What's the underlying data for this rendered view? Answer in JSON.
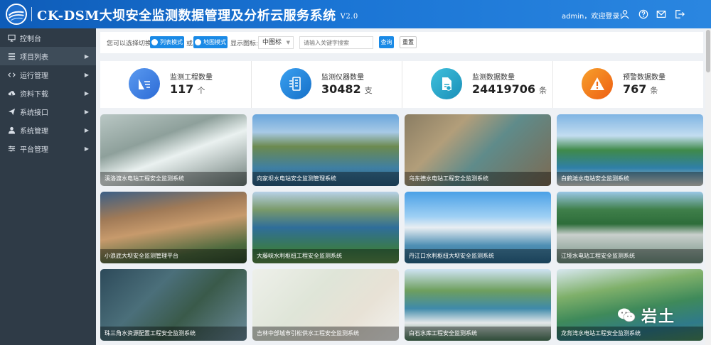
{
  "header": {
    "title": "CK-DSM大坝安全监测数据管理及分析云服务系统",
    "version": "V2.0",
    "greeting": "admin，欢迎登录!",
    "icons": [
      "user-icon",
      "help-icon",
      "mail-icon",
      "logout-icon"
    ]
  },
  "sidebar": {
    "items": [
      {
        "label": "控制台",
        "icon": "monitor-icon",
        "arrow": ""
      },
      {
        "label": "项目列表",
        "icon": "list-icon",
        "arrow": "▶"
      },
      {
        "label": "运行管理",
        "icon": "code-icon",
        "arrow": "▶"
      },
      {
        "label": "资料下载",
        "icon": "cloud-download-icon",
        "arrow": "▶"
      },
      {
        "label": "系统接口",
        "icon": "send-icon",
        "arrow": "▶"
      },
      {
        "label": "系统管理",
        "icon": "user-icon",
        "arrow": "▶"
      },
      {
        "label": "平台管理",
        "icon": "sliders-icon",
        "arrow": "▶"
      }
    ]
  },
  "toolbar": {
    "switch_text": "您可以选择切换为",
    "list_mode": "列表模式",
    "or_text": "或",
    "map_mode": "地图模式",
    "display_icon_text": "显示图标:",
    "icon_size_select": "中图标",
    "search_placeholder": "请输入关键字搜索",
    "search_button": "查询",
    "reset_button": "重置"
  },
  "stats": [
    {
      "label": "监测工程数量",
      "value": "117",
      "unit": "个",
      "color": "#3d7fe0",
      "icon": "project-icon"
    },
    {
      "label": "监测仪器数量",
      "value": "30482",
      "unit": "支",
      "color": "#1e88d8",
      "icon": "instrument-icon"
    },
    {
      "label": "监测数据数量",
      "value": "24419706",
      "unit": "条",
      "color": "#22a6c9",
      "icon": "data-file-icon"
    },
    {
      "label": "预警数据数量",
      "value": "767",
      "unit": "条",
      "color": "#f0821e",
      "icon": "warning-icon"
    }
  ],
  "projects": [
    {
      "name": "溪洛渡水电站工程安全监测系统"
    },
    {
      "name": "向家坝水电站安全监测管理系统"
    },
    {
      "name": "乌东德水电站工程安全监测系统"
    },
    {
      "name": "白鹤滩水电站安全监测系统"
    },
    {
      "name": "小浪底大坝安全监测管理平台"
    },
    {
      "name": "大藤峡水利枢纽工程安全监测系统"
    },
    {
      "name": "丹江口水利枢纽大坝安全监测系统"
    },
    {
      "name": "江垭水电站工程安全监测系统"
    },
    {
      "name": "珠三角水资源配置工程安全监测系统"
    },
    {
      "name": "吉林中部城市引松供水工程安全监测系统"
    },
    {
      "name": "白石水库工程安全监测系统"
    },
    {
      "name": "龙背湾水电站工程安全监测系统"
    }
  ],
  "watermark": "岩土"
}
